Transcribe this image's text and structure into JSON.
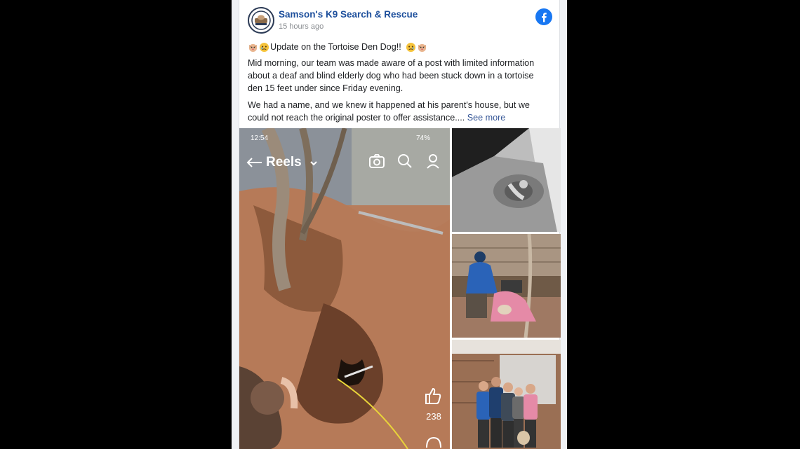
{
  "post": {
    "page_name": "Samson's K9 Search & Rescue",
    "timestamp": "15 hours ago",
    "headline": "Update on the Tortoise Den Dog!!",
    "paragraph1": "Mid morning, our team was made aware of a post with limited information about a deaf and blind elderly dog who had been stuck down in a tortoise den 15 feet under since Friday evening.",
    "paragraph2": "We had a name, and we knew it happened at his parent's house, but we could not reach the original poster to offer assistance....",
    "see_more": "See more"
  },
  "reel": {
    "time": "12:54",
    "battery": "74%",
    "label": "Reels",
    "like_count": "238"
  },
  "icons": [
    "page-avatar-icon",
    "facebook-logo-icon",
    "dog-emoji-icon",
    "teary-face-emoji-icon",
    "back-arrow-icon",
    "chevron-down-icon",
    "camera-icon",
    "search-icon",
    "profile-icon",
    "thumbs-up-icon",
    "comment-icon"
  ],
  "colors": {
    "page_name": "#1d4f9c",
    "facebook_blue": "#1877f2",
    "see_more": "#385898",
    "timestamp": "#8a8d91"
  }
}
